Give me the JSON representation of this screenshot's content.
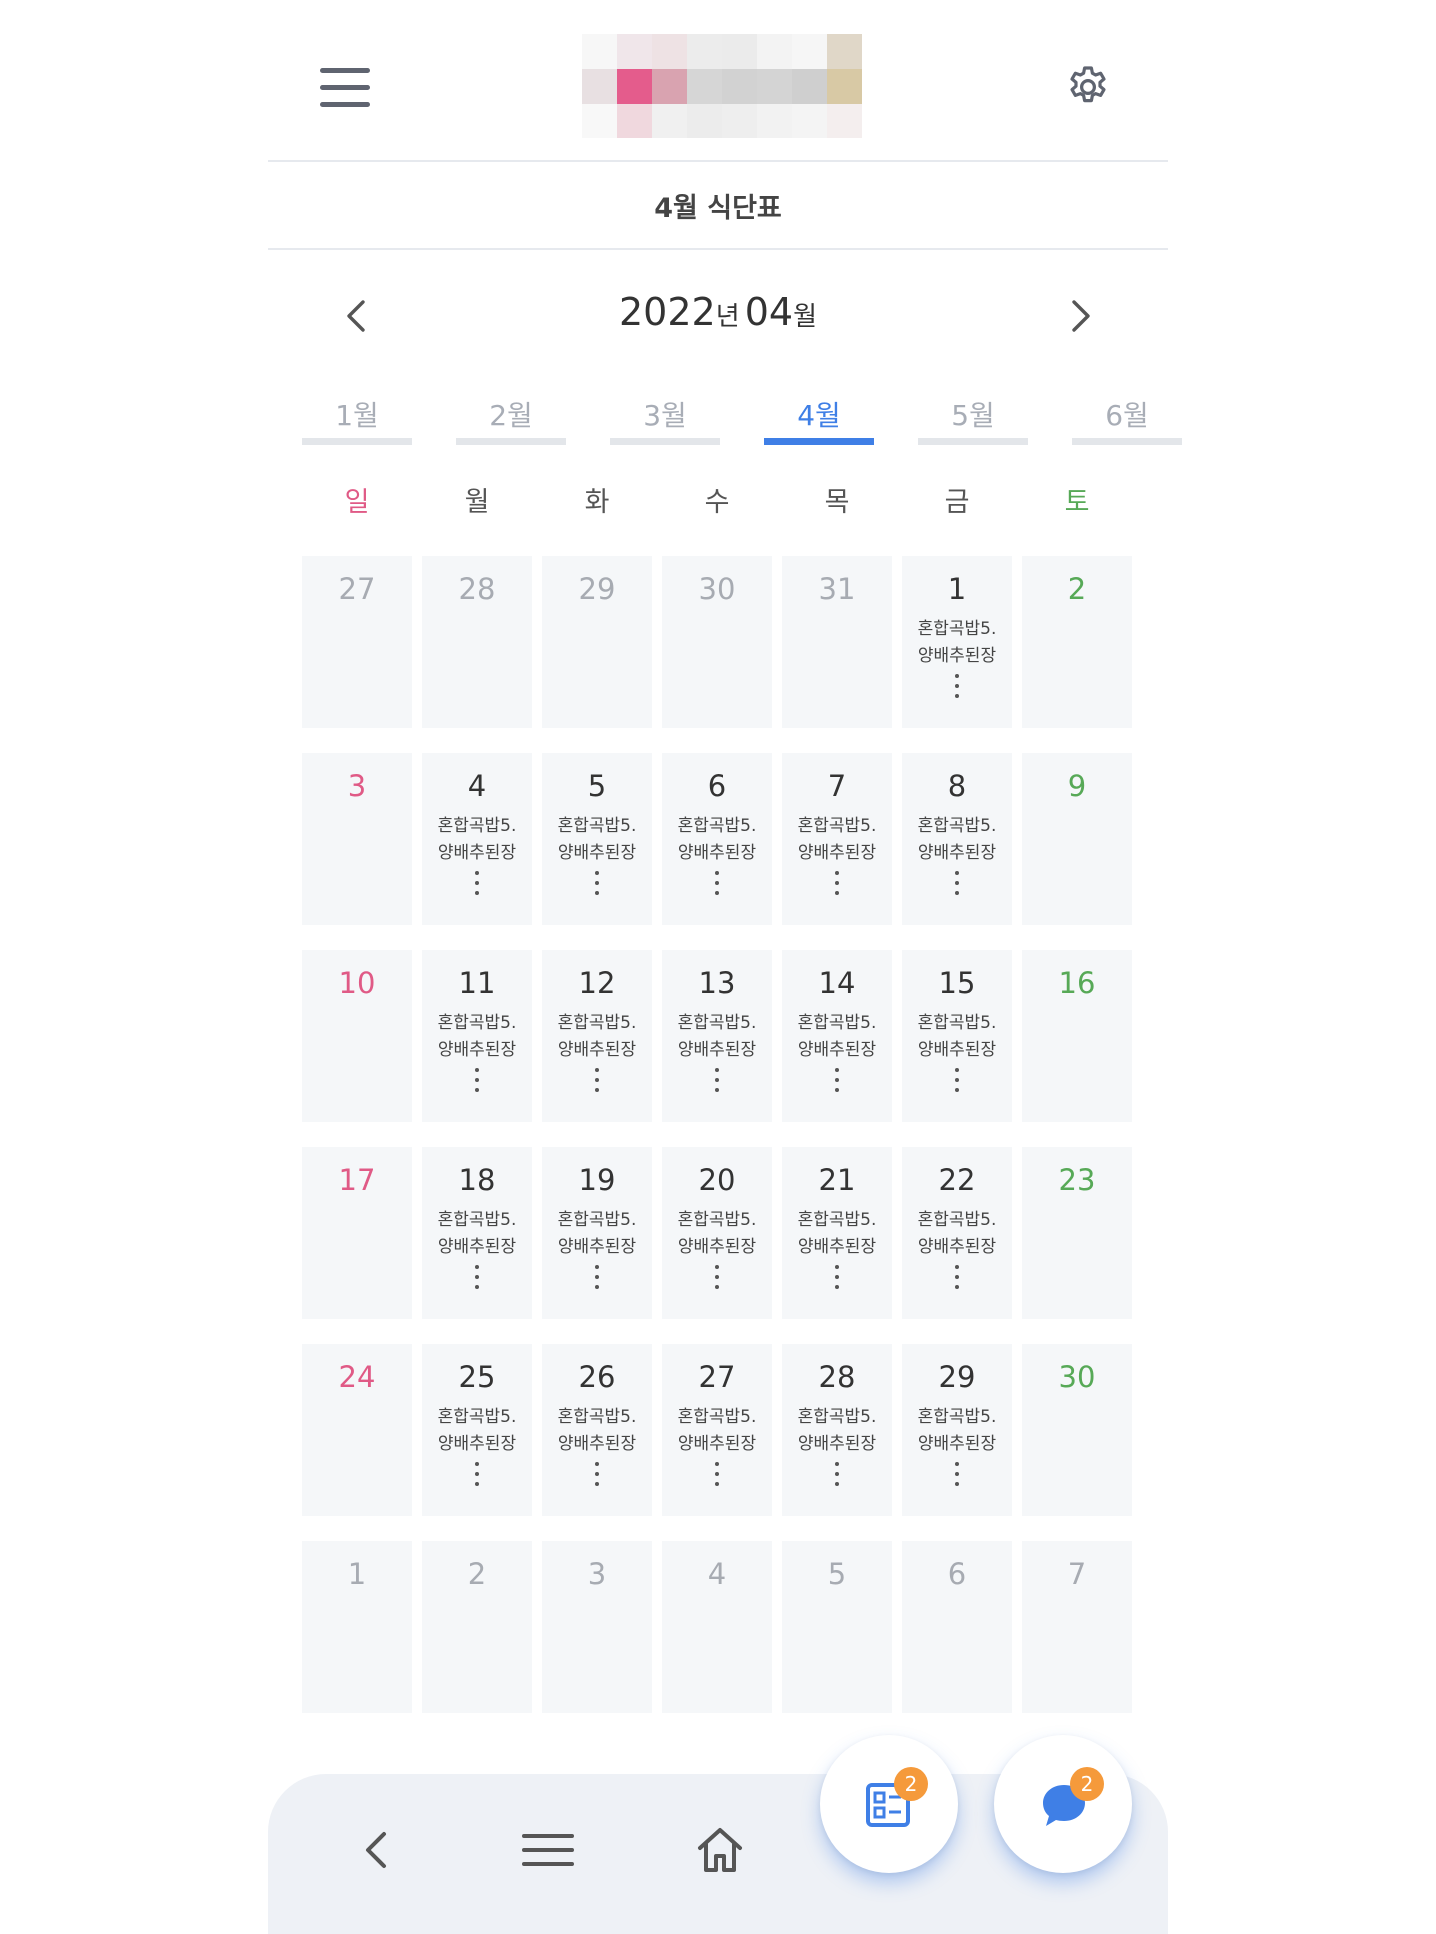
{
  "header": {
    "title": "4월 식단표",
    "logo_colors": [
      [
        "#f7f7f7",
        "#f0e6ea",
        "#eee2e4",
        "#ececec",
        "#ebebeb",
        "#f3f3f3",
        "#f6f6f6",
        "#e0d7c8"
      ],
      [
        "#e8e0e2",
        "#e45c8c",
        "#d9a3b0",
        "#d6d6d6",
        "#d2d2d2",
        "#d4d4d4",
        "#cfcfcf",
        "#d8c9a5"
      ],
      [
        "#f8f8f8",
        "#f0d8de",
        "#f0f0f0",
        "#ececec",
        "#eeeeee",
        "#f2f2f2",
        "#f4f4f4",
        "#f4eeee"
      ]
    ]
  },
  "month_nav": {
    "year": "2022",
    "year_unit": "년",
    "month": "04",
    "month_unit": "월"
  },
  "month_tabs": [
    {
      "label": "1월",
      "active": false
    },
    {
      "label": "2월",
      "active": false
    },
    {
      "label": "3월",
      "active": false
    },
    {
      "label": "4월",
      "active": true
    },
    {
      "label": "5월",
      "active": false
    },
    {
      "label": "6월",
      "active": false
    }
  ],
  "weekdays": [
    {
      "label": "일",
      "color": "#e05a86"
    },
    {
      "label": "월",
      "color": "#555555"
    },
    {
      "label": "화",
      "color": "#555555"
    },
    {
      "label": "수",
      "color": "#555555"
    },
    {
      "label": "목",
      "color": "#555555"
    },
    {
      "label": "금",
      "color": "#555555"
    },
    {
      "label": "토",
      "color": "#57a957"
    }
  ],
  "menu_preview": [
    "혼합곡밥5.",
    "양배추된장"
  ],
  "weeks": [
    [
      {
        "d": "27",
        "t": "out"
      },
      {
        "d": "28",
        "t": "out"
      },
      {
        "d": "29",
        "t": "out"
      },
      {
        "d": "30",
        "t": "out"
      },
      {
        "d": "31",
        "t": "out"
      },
      {
        "d": "1",
        "t": "meal"
      },
      {
        "d": "2",
        "t": "sat"
      }
    ],
    [
      {
        "d": "3",
        "t": "sun"
      },
      {
        "d": "4",
        "t": "meal"
      },
      {
        "d": "5",
        "t": "meal"
      },
      {
        "d": "6",
        "t": "meal"
      },
      {
        "d": "7",
        "t": "meal"
      },
      {
        "d": "8",
        "t": "meal"
      },
      {
        "d": "9",
        "t": "sat"
      }
    ],
    [
      {
        "d": "10",
        "t": "sun"
      },
      {
        "d": "11",
        "t": "meal"
      },
      {
        "d": "12",
        "t": "meal"
      },
      {
        "d": "13",
        "t": "meal"
      },
      {
        "d": "14",
        "t": "meal"
      },
      {
        "d": "15",
        "t": "meal"
      },
      {
        "d": "16",
        "t": "sat"
      }
    ],
    [
      {
        "d": "17",
        "t": "sun"
      },
      {
        "d": "18",
        "t": "meal"
      },
      {
        "d": "19",
        "t": "meal"
      },
      {
        "d": "20",
        "t": "meal"
      },
      {
        "d": "21",
        "t": "meal"
      },
      {
        "d": "22",
        "t": "meal"
      },
      {
        "d": "23",
        "t": "sat"
      }
    ],
    [
      {
        "d": "24",
        "t": "sun"
      },
      {
        "d": "25",
        "t": "meal"
      },
      {
        "d": "26",
        "t": "meal"
      },
      {
        "d": "27",
        "t": "meal"
      },
      {
        "d": "28",
        "t": "meal"
      },
      {
        "d": "29",
        "t": "meal"
      },
      {
        "d": "30",
        "t": "sat"
      }
    ],
    [
      {
        "d": "1",
        "t": "out"
      },
      {
        "d": "2",
        "t": "out"
      },
      {
        "d": "3",
        "t": "out"
      },
      {
        "d": "4",
        "t": "out"
      },
      {
        "d": "5",
        "t": "out"
      },
      {
        "d": "6",
        "t": "out"
      },
      {
        "d": "7",
        "t": "out"
      }
    ]
  ],
  "fab": {
    "board_badge": "2",
    "chat_badge": "2"
  },
  "colors": {
    "accent": "#3f7fe6",
    "badge": "#f59a3b",
    "sunday": "#e05a86",
    "saturday": "#57a957"
  }
}
